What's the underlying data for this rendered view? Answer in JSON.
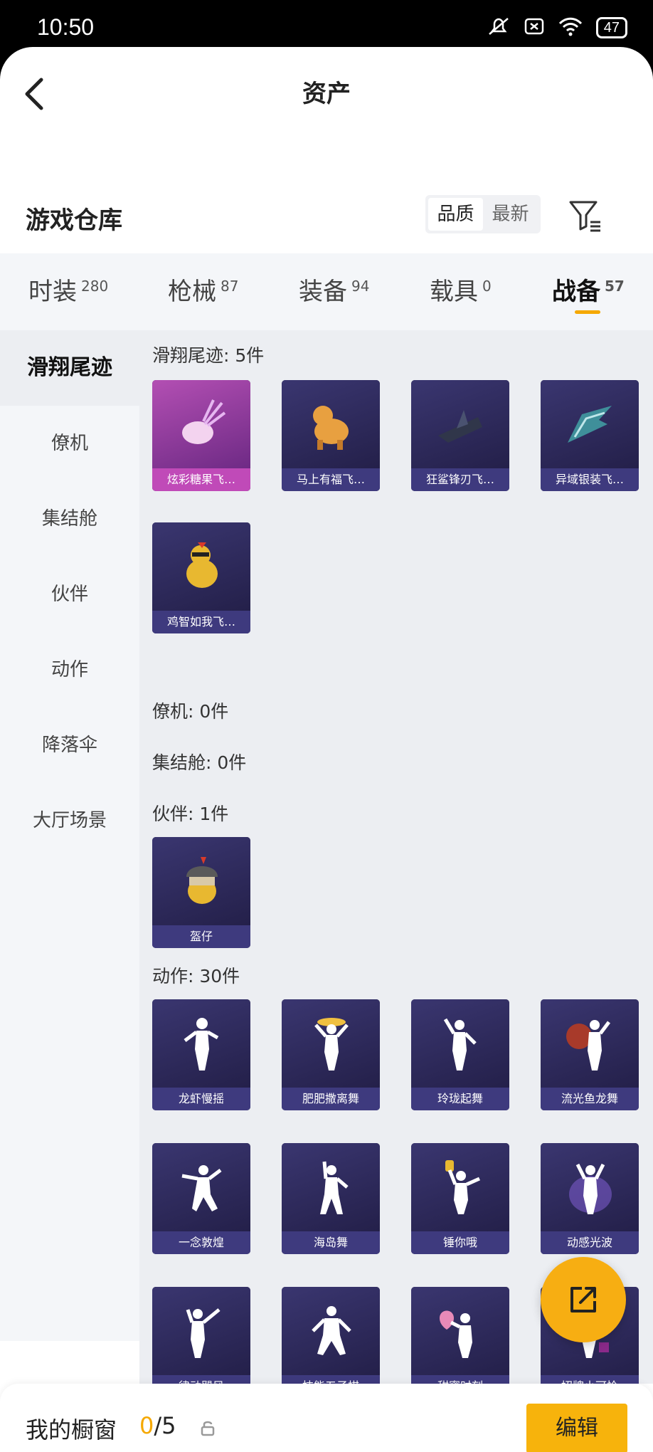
{
  "status": {
    "time": "10:50",
    "battery": "47"
  },
  "header": {
    "title": "资产"
  },
  "storage": {
    "title": "游戏仓库",
    "sort_options": [
      "品质",
      "最新"
    ]
  },
  "tabs": [
    {
      "label": "时装",
      "count": "280"
    },
    {
      "label": "枪械",
      "count": "87"
    },
    {
      "label": "装备",
      "count": "94"
    },
    {
      "label": "载具",
      "count": "0"
    },
    {
      "label": "战备",
      "count": "57"
    }
  ],
  "sidebar": [
    "滑翔尾迹",
    "僚机",
    "集结舱",
    "伙伴",
    "动作",
    "降落伞",
    "大厅场景"
  ],
  "sections": {
    "glide": {
      "title": "滑翔尾迹: 5件",
      "items": [
        "炫彩糖果飞…",
        "马上有福飞…",
        "狂鲨锋刃飞…",
        "异域银装飞…",
        "鸡智如我飞…"
      ]
    },
    "wingman": {
      "title": "僚机: 0件"
    },
    "pod": {
      "title": "集结舱: 0件"
    },
    "partner": {
      "title": "伙伴: 1件",
      "items": [
        "盔仔"
      ]
    },
    "emote": {
      "title": "动作: 30件",
      "items": [
        "龙虾慢摇",
        "肥肥撒离舞",
        "玲珑起舞",
        "流光鱼龙舞",
        "一念敦煌",
        "海岛舞",
        "锤你哦",
        "动感光波",
        "律动飓风",
        "技能五子棋",
        "甜蜜时刻",
        "招牌小可怜"
      ]
    }
  },
  "bottom": {
    "label": "我的橱窗",
    "current": "0",
    "total": "/5",
    "edit": "编辑"
  },
  "colors": {
    "accent": "#f7b30c",
    "card": "#2c2852",
    "pink_card": "#c04ab8"
  }
}
